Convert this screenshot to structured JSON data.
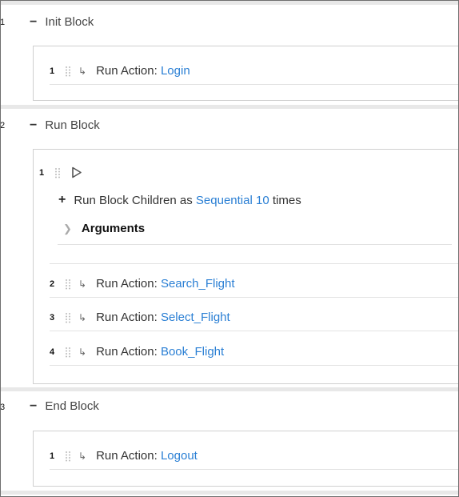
{
  "blocks": [
    {
      "number": "1",
      "title": "Init Block",
      "steps": [
        {
          "number": "1",
          "prefix": "Run Action:",
          "link": "Login"
        }
      ]
    },
    {
      "number": "2",
      "title": "Run Block",
      "loop": {
        "number": "1",
        "children_prefix": "Run Block Children as",
        "mode": "Sequential",
        "count": "10",
        "suffix": "times",
        "arguments_label": "Arguments"
      },
      "steps": [
        {
          "number": "2",
          "prefix": "Run Action:",
          "link": "Search_Flight"
        },
        {
          "number": "3",
          "prefix": "Run Action:",
          "link": "Select_Flight"
        },
        {
          "number": "4",
          "prefix": "Run Action:",
          "link": "Book_Flight"
        }
      ]
    },
    {
      "number": "3",
      "title": "End Block",
      "steps": [
        {
          "number": "1",
          "prefix": "Run Action:",
          "link": "Logout"
        }
      ]
    }
  ],
  "colors": {
    "link": "#2a7fd4",
    "text": "#333333",
    "border": "#d0d0d0"
  },
  "icons": [
    "collapse-minus-icon",
    "drag-grip-icon",
    "action-arrow-icon",
    "play-icon",
    "expand-plus-icon",
    "chevron-right-icon"
  ]
}
